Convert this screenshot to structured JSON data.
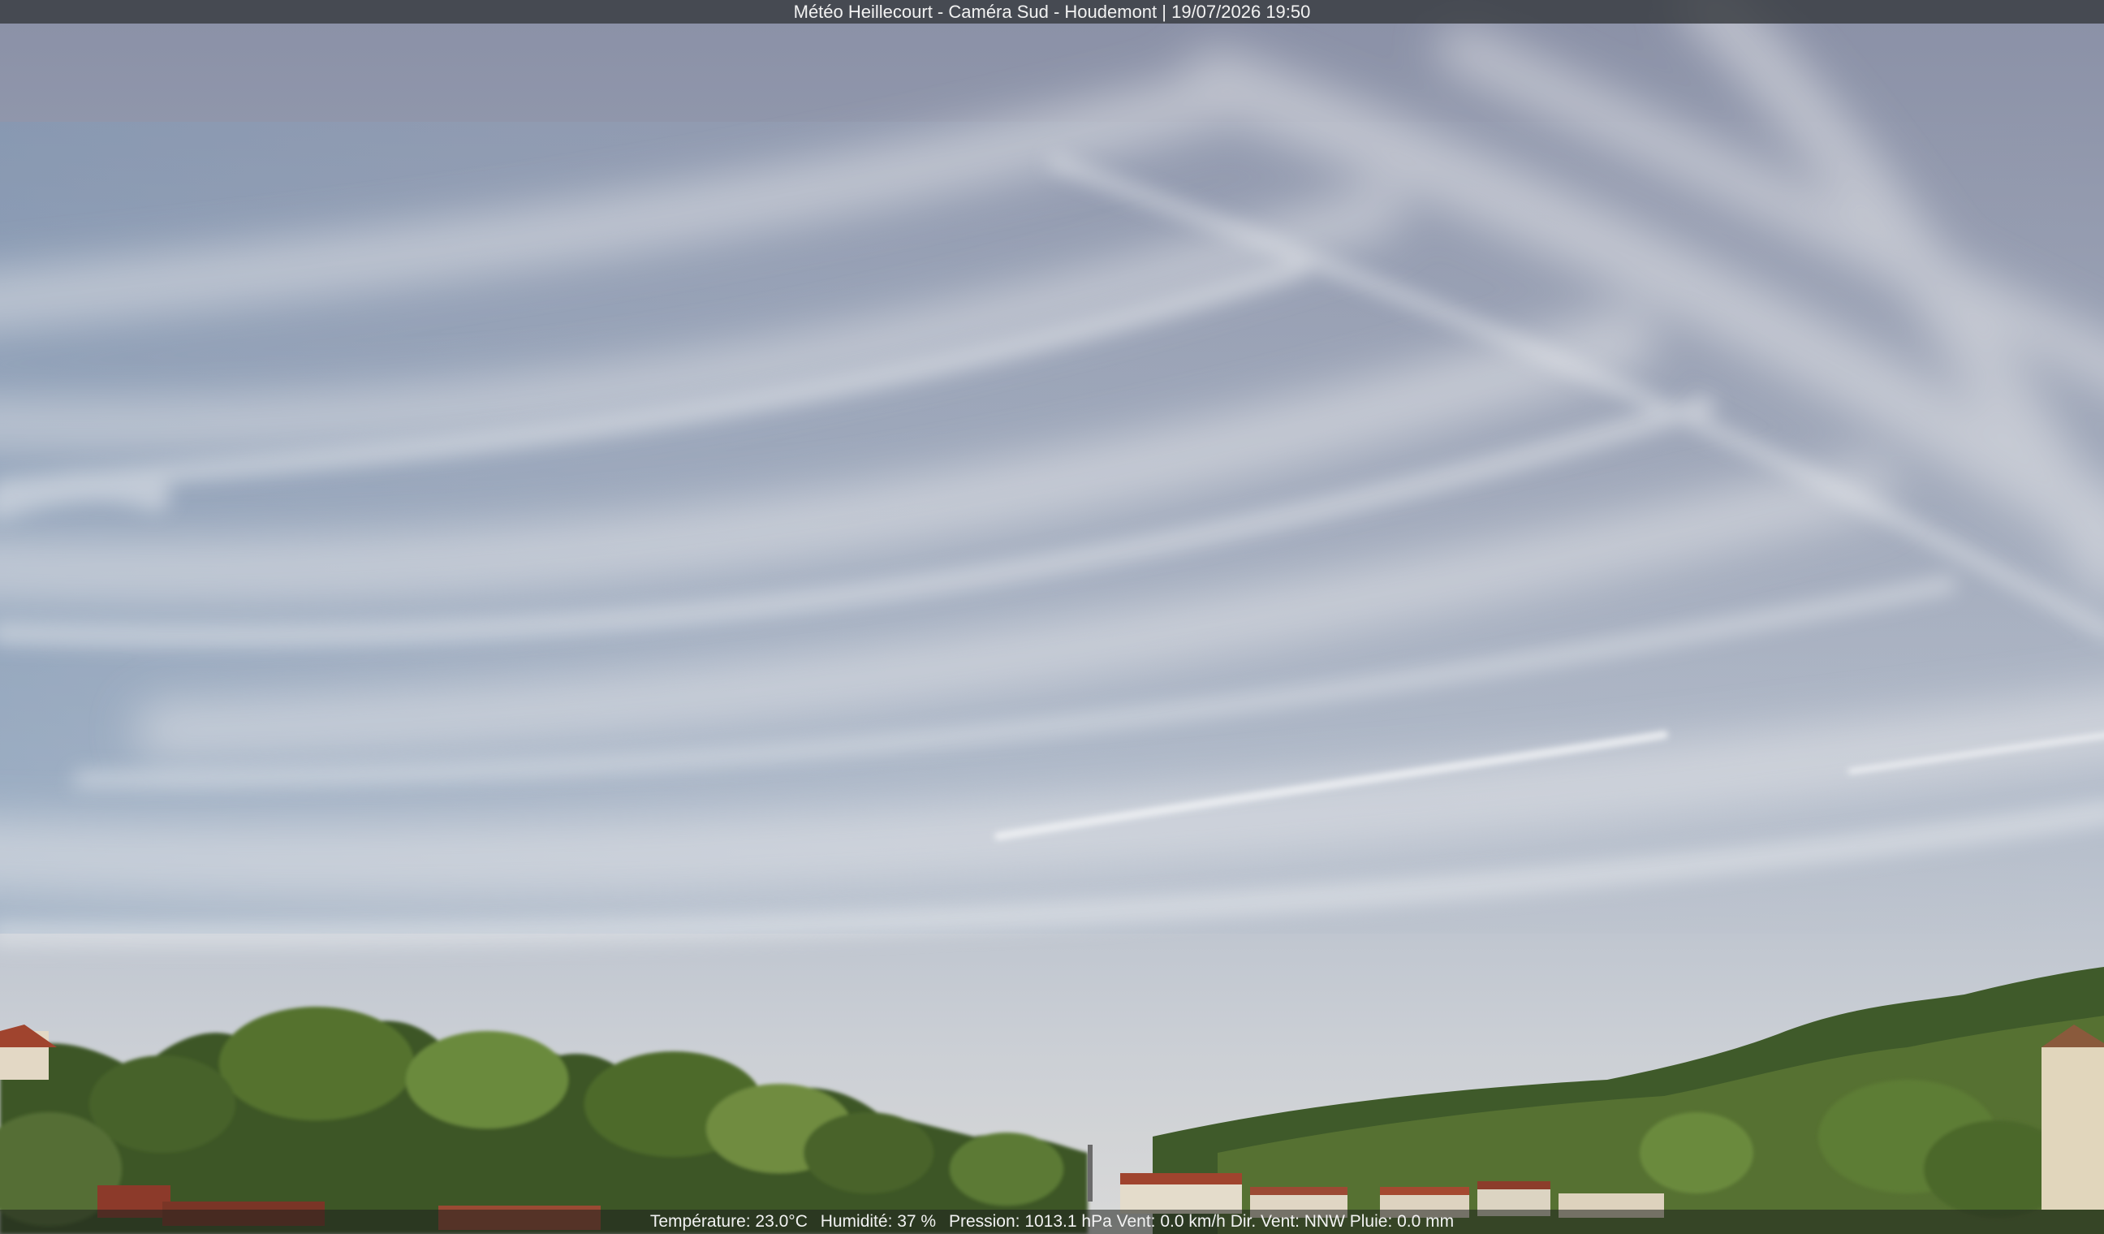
{
  "header": {
    "caption": "Météo Heillecourt - Caméra Sud - Houdemont | 19/07/2026 19:50"
  },
  "footer": {
    "temperature": "Température: 23.0°C",
    "humidity": "Humidité: 37 %",
    "pressure": "Pression: 1013.1 hPa",
    "wind": "Vent: 0.0 km/h",
    "wind_direction": "Dir. Vent: NNW",
    "rain": "Pluie: 0.0 mm"
  },
  "colors": {
    "sky_top": "#8c93a8",
    "sky_mid": "#a9b3c4",
    "sky_low": "#c9ccd2",
    "foliage_dark": "#2f4722",
    "foliage_light": "#6f8a3e",
    "roof": "#a0442e",
    "wall": "#e4dccb"
  }
}
